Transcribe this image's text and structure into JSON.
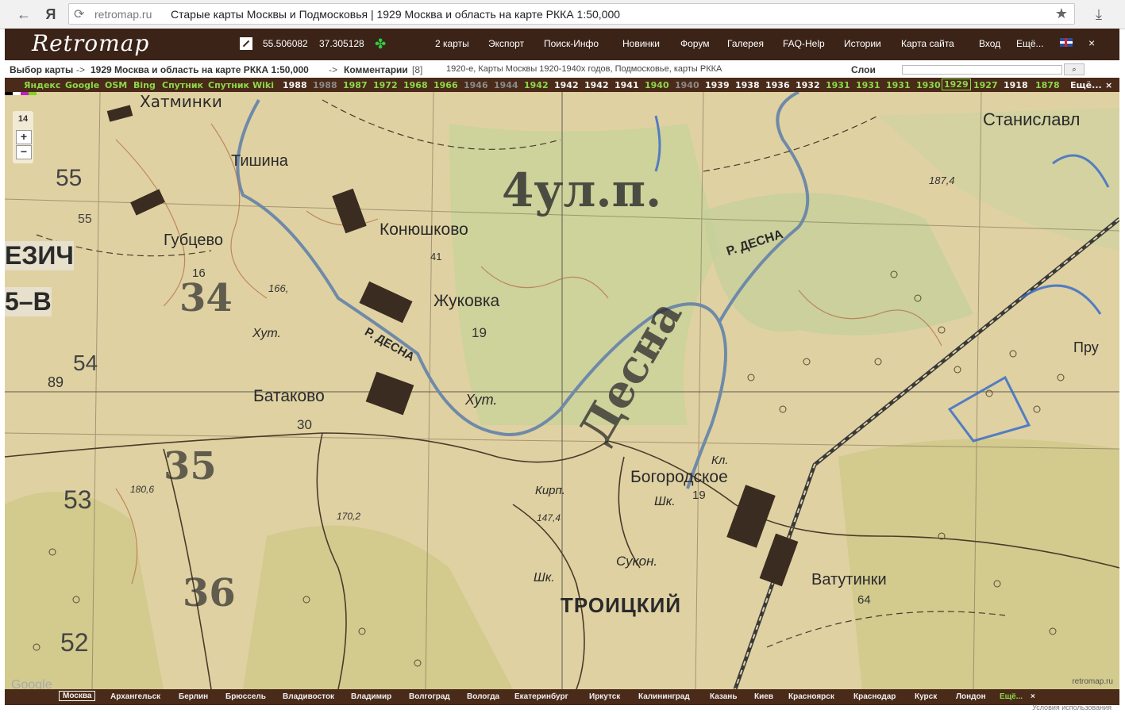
{
  "browser": {
    "back_icon": "back-arrow-icon",
    "site_icon": "yandex-icon",
    "site_glyph": "Я",
    "host": "retromap.ru",
    "title": "Старые карты Москвы и Подмосковья | 1929 Москва и область на карте РККА 1:50,000",
    "download_icon": "download-icon"
  },
  "header": {
    "logo": "Retromap",
    "lat": "55.506082",
    "lon": "37.305128",
    "menu": [
      "2 карты",
      "Экспорт",
      "Поиск-Инфо",
      "Новинки",
      "Форум",
      "Галерея",
      "FAQ-Help",
      "Истории",
      "Карта сайта",
      "Вход",
      "Ещё..."
    ],
    "close": "×"
  },
  "breadcrumb": {
    "select": "Выбор карты",
    "sep1": "->",
    "map_name": "1929 Москва и область на карте РККА 1:50,000",
    "sep2": "->",
    "comments": "Комментарии",
    "comments_count": "[8]",
    "tags": "1920-е, Карты Москвы 1920-1940х годов, Подмосковье, карты РККА",
    "layers": "Слои"
  },
  "years": [
    {
      "t": "Яндекс",
      "s": "green"
    },
    {
      "t": "Google",
      "s": "green"
    },
    {
      "t": "OSM",
      "s": "green"
    },
    {
      "t": "Bing",
      "s": "green"
    },
    {
      "t": "Спутник",
      "s": "green"
    },
    {
      "t": "Спутник",
      "s": "green"
    },
    {
      "t": "Wiki",
      "s": "green"
    },
    {
      "t": "1988",
      "s": "on"
    },
    {
      "t": "1988",
      "s": "off"
    },
    {
      "t": "1987",
      "s": "green"
    },
    {
      "t": "1972",
      "s": "green"
    },
    {
      "t": "1968",
      "s": "green"
    },
    {
      "t": "1966",
      "s": "green"
    },
    {
      "t": "1946",
      "s": "off"
    },
    {
      "t": "1944",
      "s": "off"
    },
    {
      "t": "1942",
      "s": "green"
    },
    {
      "t": "1942",
      "s": "on"
    },
    {
      "t": "1942",
      "s": "on"
    },
    {
      "t": "1941",
      "s": "on"
    },
    {
      "t": "1940",
      "s": "green"
    },
    {
      "t": "1940",
      "s": "off"
    },
    {
      "t": "1939",
      "s": "on"
    },
    {
      "t": "1938",
      "s": "on"
    },
    {
      "t": "1936",
      "s": "on"
    },
    {
      "t": "1932",
      "s": "on"
    },
    {
      "t": "1931",
      "s": "green"
    },
    {
      "t": "1931",
      "s": "green"
    },
    {
      "t": "1931",
      "s": "green"
    },
    {
      "t": "1930",
      "s": "green"
    },
    {
      "t": "1929",
      "s": "sel"
    },
    {
      "t": "1927",
      "s": "green"
    },
    {
      "t": "1918",
      "s": "on"
    },
    {
      "t": "1878",
      "s": "green"
    },
    {
      "t": "Ещё...",
      "s": "on"
    },
    {
      "t": "×",
      "s": "on"
    }
  ],
  "map": {
    "zoom_level": "14",
    "zoom_in": "+",
    "zoom_out": "−",
    "watermark": "retromap.ru",
    "labels": {
      "hatminki": "Хатминки",
      "tishina": "Тишина",
      "gubtsevo": "Губцево",
      "konyushkovo": "Конюшково",
      "zhukovka": "Жуковка",
      "batakovo": "Батаково",
      "bogorodskoe": "Богородское",
      "vatutinki": "Ватутинки",
      "troitsky": "ТРОИЦКИЙ",
      "stanislavl": "Станиславл",
      "desna_1": "Р. ДЕСНА",
      "desna_2": "Р. ДЕСНА",
      "hut_1": "Хут.",
      "hut_2": "Хут.",
      "kirp": "Кирп.",
      "shk_1": "Шк.",
      "shk_2": "Шк.",
      "sukon": "Сукон.",
      "kl": "Кл.",
      "pru": "Пру",
      "ezich": "ЕЗИЧ",
      "b": "5–В",
      "n55a": "55",
      "n55b": "55",
      "n54": "54",
      "n53": "53",
      "n52": "52",
      "n89": "89",
      "n16": "16",
      "n19a": "19",
      "n19b": "19",
      "n30": "30",
      "n41": "41",
      "n64": "64",
      "h166": "166,",
      "h1874": "187,4",
      "h1806": "180,6",
      "h1702": "170,2",
      "h1474": "147,4",
      "hw_1": "4ул.п.",
      "hw_2": "Десна",
      "hw_3": "34",
      "hw_4": "35",
      "hw_5": "36"
    }
  },
  "cities": [
    "Москва",
    "Архангельск",
    "Берлин",
    "Брюссель",
    "Владивосток",
    "Владимир",
    "Волгоград",
    "Вологда",
    "Екатеринбург",
    "Иркутск",
    "Калининград",
    "Казань",
    "Киев",
    "Красноярск",
    "Краснодар",
    "Курск",
    "Лондон",
    "Ещё...",
    "×"
  ],
  "footer": {
    "google": "Google",
    "terms": "Условия использования"
  }
}
